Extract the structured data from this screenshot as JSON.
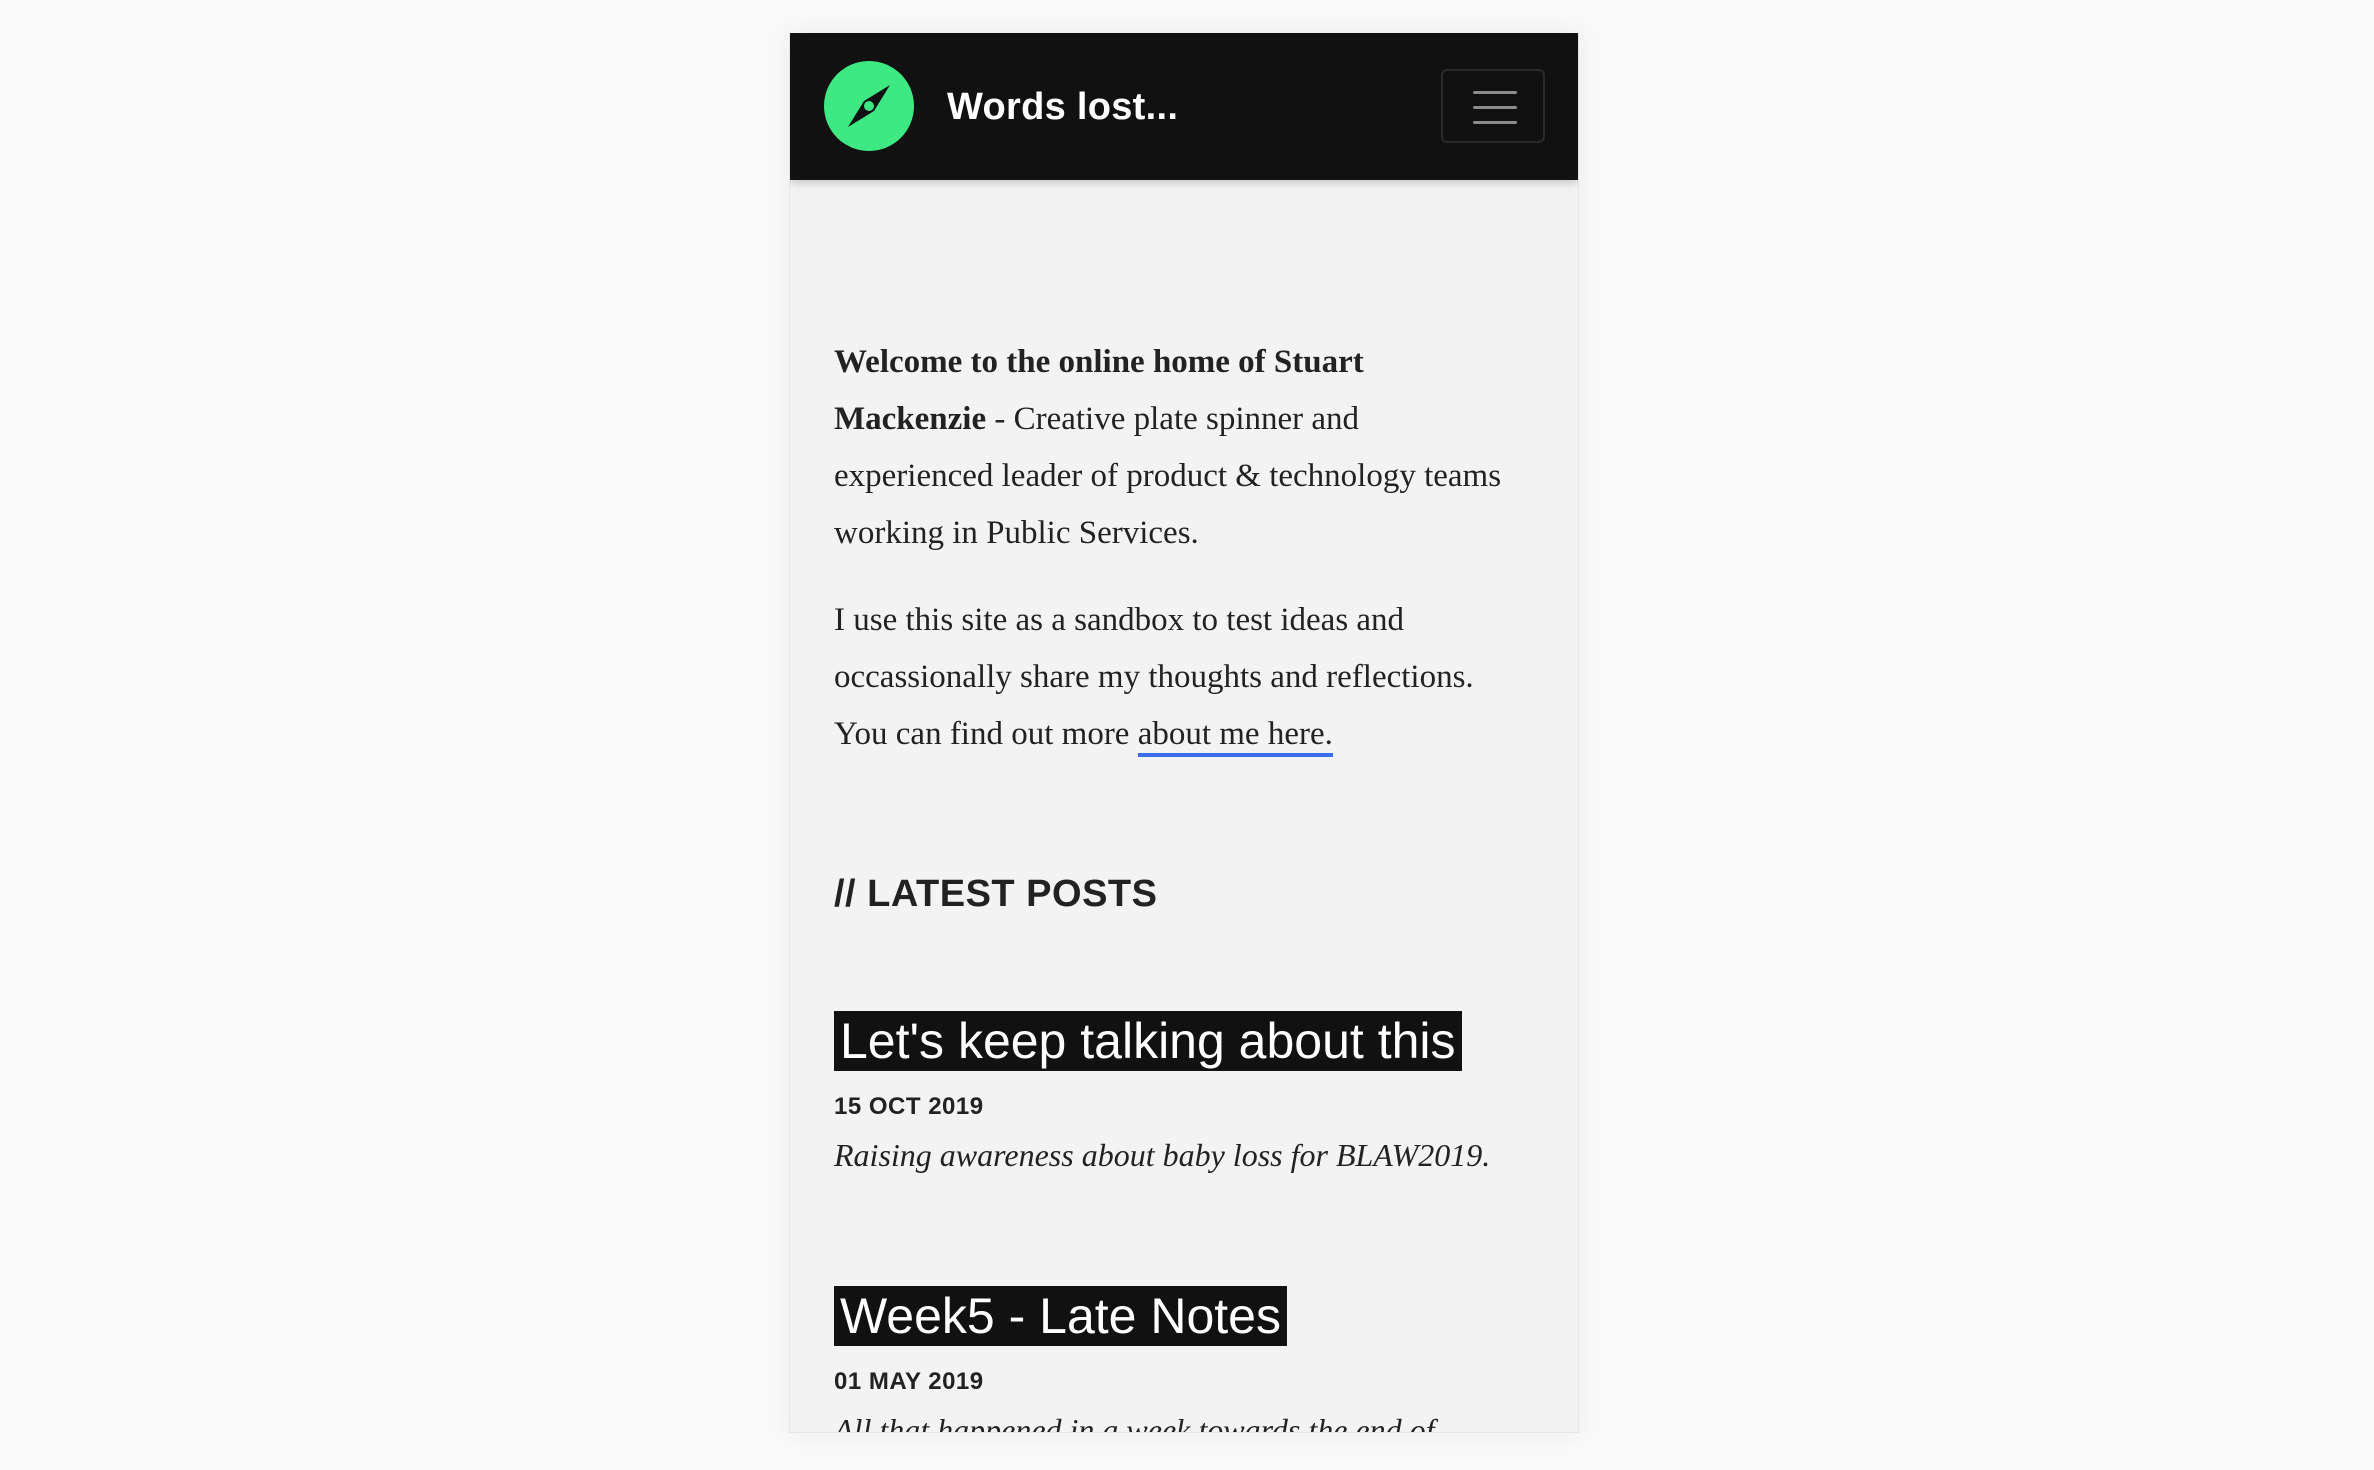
{
  "header": {
    "brand": "Words lost...",
    "logo_icon": "compass-icon",
    "menu_icon": "hamburger-menu-icon",
    "accent_color": "#3ee882"
  },
  "intro": {
    "bold_text": "Welcome to the online home of Stuart Mackenzie",
    "rest_text": " - Creative plate spinner and experienced leader of product & technology teams working in Public Services.",
    "sandbox_text": "I use this site as a sandbox to test ideas and occassionally share my thoughts and reflections. You can find out more ",
    "about_link": "about me here."
  },
  "latest_posts": {
    "heading": "// LATEST POSTS",
    "posts": [
      {
        "title": "Let's keep talking about this",
        "date": "15 OCT 2019",
        "excerpt": "Raising awareness about baby loss for BLAW2019."
      },
      {
        "title": "Week5 - Late Notes",
        "date": "01 MAY 2019",
        "excerpt": "All that happened in a week towards the end of"
      }
    ]
  },
  "colors": {
    "navbar": "#111111",
    "link_underline": "#3a6ee8",
    "page_background": "#f3f3f3"
  }
}
